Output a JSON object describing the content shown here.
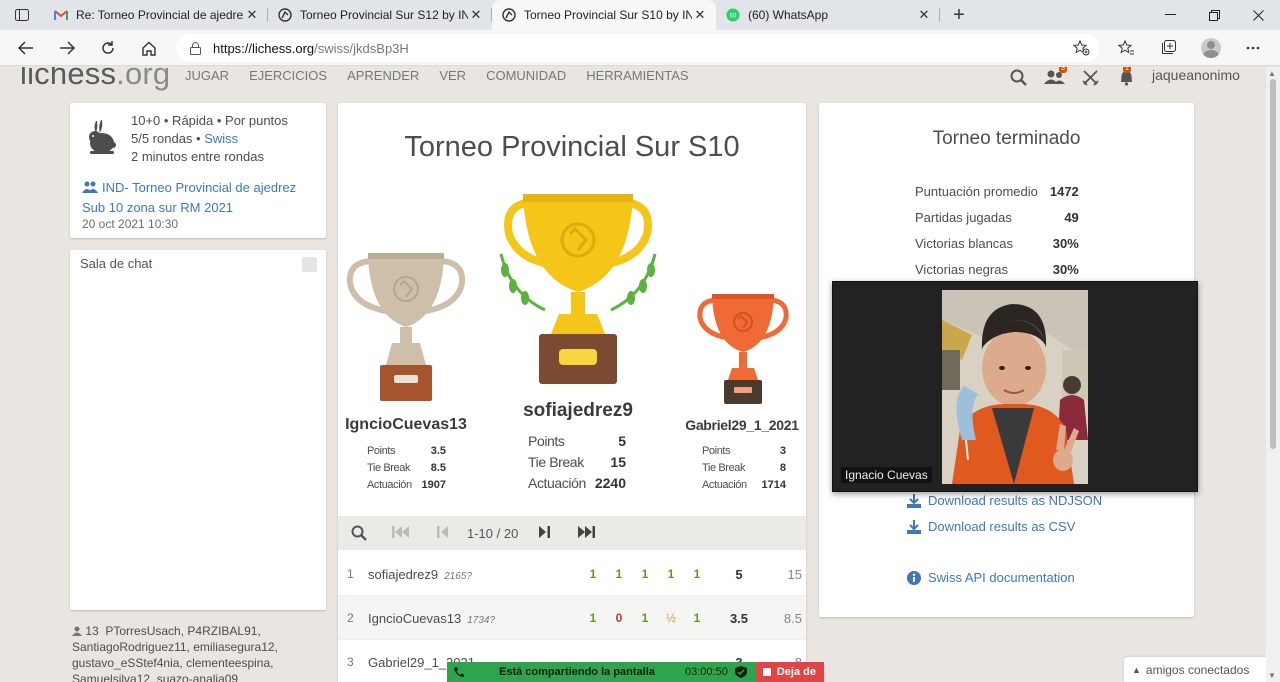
{
  "browser": {
    "tabs": [
      {
        "label": "Re: Torneo Provincial de ajedrez",
        "favicon": "gmail-icon",
        "active": false
      },
      {
        "label": "Torneo Provincial Sur S12 by IND",
        "favicon": "lichess-icon",
        "active": false
      },
      {
        "label": "Torneo Provincial Sur S10 by IND",
        "favicon": "lichess-icon",
        "active": true
      },
      {
        "label": "(60) WhatsApp",
        "favicon": "whatsapp-icon",
        "active": false,
        "badge": "60"
      }
    ],
    "close_glyph": "✕",
    "new_tab_glyph": "+",
    "url_host": "https://lichess.org",
    "url_path": "/swiss/jkdsBp3H"
  },
  "site": {
    "logo_main": "lichess",
    "logo_tld": ".org",
    "nav": [
      "JUGAR",
      "EJERCICIOS",
      "APRENDER",
      "VER",
      "COMUNIDAD",
      "HERRAMIENTAS"
    ],
    "username": "jaqueanonimo",
    "friends_badge": "3",
    "notif_badge": "1"
  },
  "info": {
    "line1": "10+0 • Rápida • Por puntos",
    "line2_prefix": "5/5 rondas • ",
    "line2_link": "Swiss",
    "line3": "2 minutos entre rondas",
    "team": "IND- Torneo Provincial de ajedrez Sub 10 zona sur RM 2021",
    "date": "20 oct 2021 10:30"
  },
  "chat": {
    "title": "Sala de chat"
  },
  "online": {
    "count": "13",
    "names": "PTorresUsach, P4RZIBAL91, SantiagoRodriguez11, emiliasegura12, gustavo_eSStef4nia, clementeespina, Samuelsilva12, suazo-analia09"
  },
  "podium": {
    "title": "Torneo Provincial Sur S10",
    "labels": {
      "points": "Points",
      "tiebreak": "Tie Break",
      "performance": "Actuación"
    },
    "first": {
      "name": "sofiajedrez9",
      "points": "5",
      "tiebreak": "15",
      "performance": "2240"
    },
    "second": {
      "name": "IgncioCuevas13",
      "points": "3.5",
      "tiebreak": "8.5",
      "performance": "1907"
    },
    "third": {
      "name": "Gabriel29_1_2021",
      "points": "3",
      "tiebreak": "8",
      "performance": "1714"
    }
  },
  "pager": {
    "text": "1-10 / 20"
  },
  "standings": [
    {
      "rank": "1",
      "name": "sofiajedrez9",
      "rating": "2165?",
      "results": [
        "1",
        "1",
        "1",
        "1",
        "1"
      ],
      "points": "5",
      "tiebreak": "15"
    },
    {
      "rank": "2",
      "name": "IgncioCuevas13",
      "rating": "1734?",
      "results": [
        "1",
        "0",
        "1",
        "½",
        "1"
      ],
      "points": "3.5",
      "tiebreak": "8.5"
    },
    {
      "rank": "3",
      "name": "Gabriel29_1_2021",
      "rating": "",
      "results": [
        "",
        "",
        "",
        "",
        ""
      ],
      "points": "3",
      "tiebreak": "8"
    }
  ],
  "stats": {
    "title": "Torneo terminado",
    "rows": [
      {
        "label": "Puntuación promedio",
        "value": "1472"
      },
      {
        "label": "Partidas jugadas",
        "value": "49"
      },
      {
        "label": "Victorias blancas",
        "value": "30%"
      },
      {
        "label": "Victorias negras",
        "value": "30%"
      }
    ],
    "download_ndjson": "Download results as NDJSON",
    "download_csv": "Download results as CSV",
    "api_docs": "Swiss API documentation"
  },
  "video": {
    "participant": "Ignacio Cuevas"
  },
  "sharing": {
    "text": "Está compartiendo la pantalla",
    "time": "03:00:50",
    "stop": "Deja de"
  },
  "friends_panel": {
    "label": "amigos conectados"
  },
  "colors": {
    "link": "#3f79b5",
    "win": "#629924",
    "loss": "#cc3333",
    "draw": "#c9a32f",
    "gold": "#f5c518",
    "silver": "#cdbfaa",
    "bronze": "#f06a35"
  }
}
